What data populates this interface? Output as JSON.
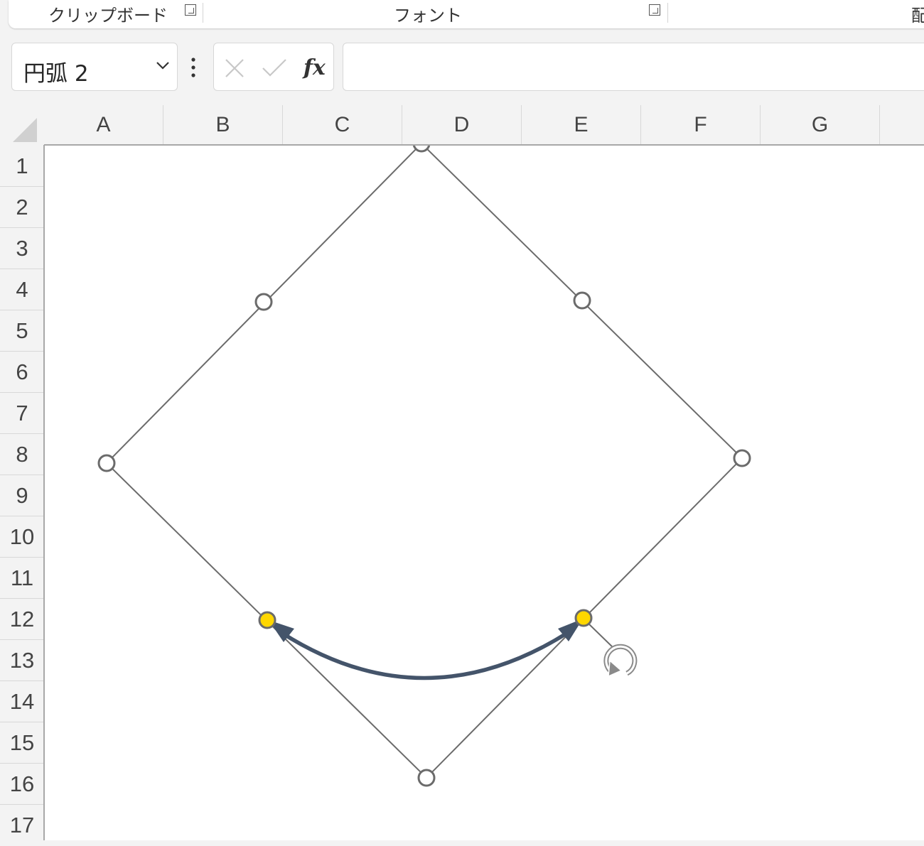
{
  "ribbon": {
    "groups": [
      {
        "label": "クリップボード"
      },
      {
        "label": "フォント"
      },
      {
        "label": "配"
      }
    ]
  },
  "formula_bar": {
    "name_box_value": "円弧 2",
    "cancel_icon": "x-icon",
    "enter_icon": "check-icon",
    "function_label": "fx",
    "formula_value": ""
  },
  "grid": {
    "columns": [
      "A",
      "B",
      "C",
      "D",
      "E",
      "F",
      "G"
    ],
    "rows": [
      "1",
      "2",
      "3",
      "4",
      "5",
      "6",
      "7",
      "8",
      "9",
      "10",
      "11",
      "12",
      "13",
      "14",
      "15",
      "16",
      "17"
    ]
  },
  "shape": {
    "name": "円弧 2",
    "type": "arc",
    "line_color": "#44546a",
    "selection_handle_color": "#ffffff",
    "adjust_handle_color": "#ffd700",
    "rotation_icon": "rotate-handle-icon"
  }
}
